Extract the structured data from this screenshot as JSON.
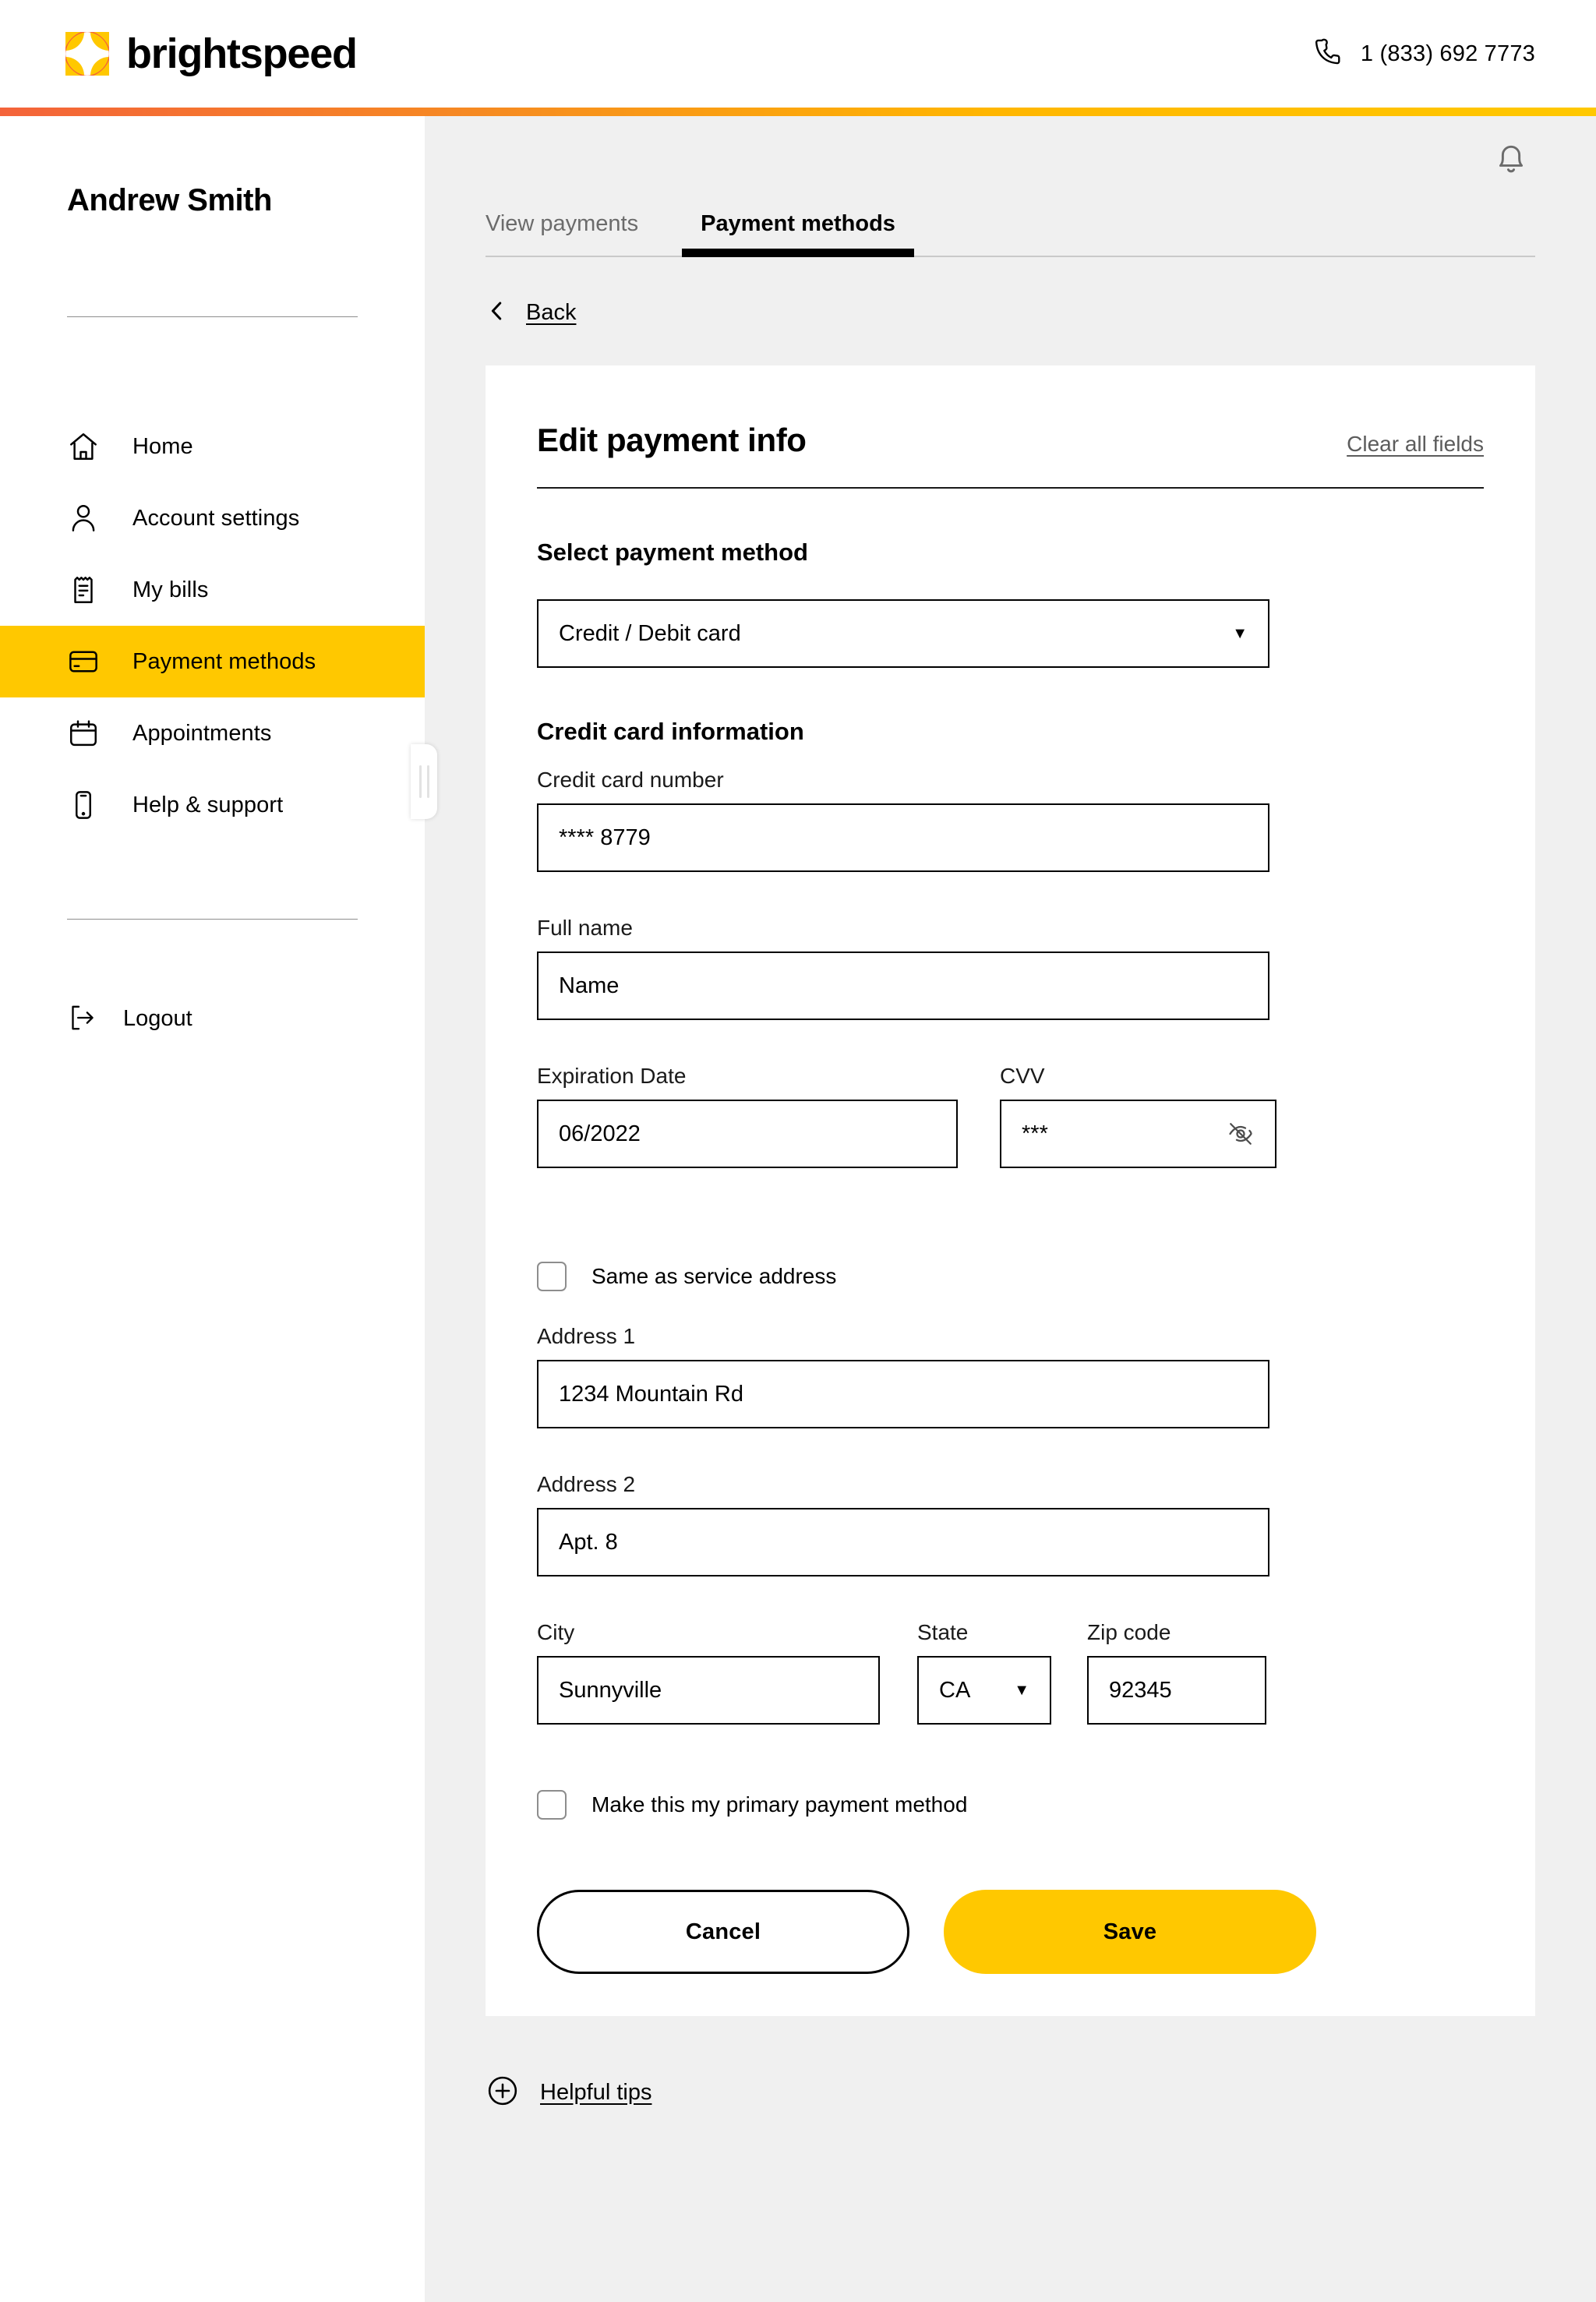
{
  "header": {
    "brand_name": "brightspeed",
    "logo_icon": "brightspeed-logo-icon",
    "phone_icon": "phone-icon",
    "phone_number": "1 (833) 692 7773",
    "accent_gradient_from": "#F4633A",
    "accent_gradient_to": "#FFC800"
  },
  "sidebar": {
    "user_name": "Andrew Smith",
    "items": [
      {
        "label": "Home",
        "icon": "home-icon",
        "active": false
      },
      {
        "label": "Account settings",
        "icon": "user-icon",
        "active": false
      },
      {
        "label": "My bills",
        "icon": "receipt-icon",
        "active": false
      },
      {
        "label": "Payment methods",
        "icon": "credit-card-icon",
        "active": true
      },
      {
        "label": "Appointments",
        "icon": "calendar-icon",
        "active": false
      },
      {
        "label": "Help & support",
        "icon": "mobile-phone-icon",
        "active": false
      }
    ],
    "logout_label": "Logout",
    "logout_icon": "logout-icon",
    "active_highlight_color": "#FFC800",
    "drag_handle_icon": "resize-handle-icon"
  },
  "main": {
    "notifications_icon": "bell-icon",
    "tabs": [
      {
        "label": "View payments",
        "active": false
      },
      {
        "label": "Payment methods",
        "active": true
      }
    ],
    "back_label": "Back",
    "back_icon": "chevron-left-icon",
    "helpful_tips_label": "Helpful tips",
    "helpful_tips_icon": "plus-circle-icon"
  },
  "form": {
    "title": "Edit payment info",
    "clear_all_label": "Clear all fields",
    "select_method_label": "Select payment method",
    "payment_method_value": "Credit / Debit card",
    "payment_method_caret": "chevron-down-icon",
    "credit_section_title": "Credit card information",
    "card_number_label": "Credit card number",
    "card_number_value": "**** 8779",
    "full_name_label": "Full name",
    "full_name_value": "Name",
    "expiration_label": "Expiration Date",
    "expiration_value": "06/2022",
    "cvv_label": "CVV",
    "cvv_value": "***",
    "cvv_toggle_icon": "eye-off-icon",
    "same_address_label": "Same as service address",
    "same_address_checked": false,
    "address1_label": "Address 1",
    "address1_value": "1234 Mountain Rd",
    "address2_label": "Address 2",
    "address2_value": "Apt. 8",
    "city_label": "City",
    "city_value": "Sunnyville",
    "state_label": "State",
    "state_value": "CA",
    "zip_label": "Zip code",
    "zip_value": "92345",
    "primary_method_label": "Make this my primary payment method",
    "primary_method_checked": false,
    "cancel_label": "Cancel",
    "save_label": "Save",
    "save_button_color": "#FFC800"
  }
}
